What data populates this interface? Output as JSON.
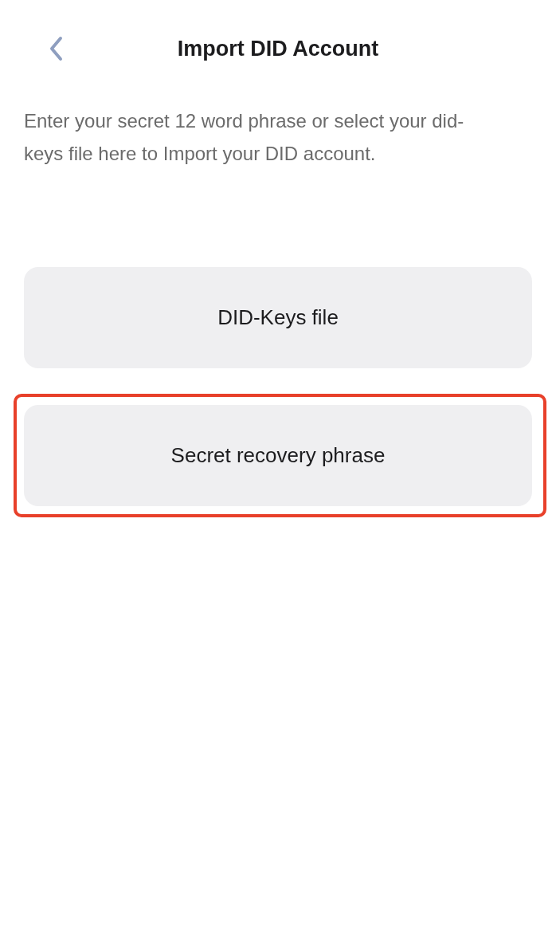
{
  "header": {
    "title": "Import DID Account"
  },
  "description": "Enter your secret 12 word phrase or select your did-keys file here to Import your DID account.",
  "options": [
    {
      "label": "DID-Keys file",
      "highlighted": false
    },
    {
      "label": "Secret recovery phrase",
      "highlighted": true
    }
  ]
}
